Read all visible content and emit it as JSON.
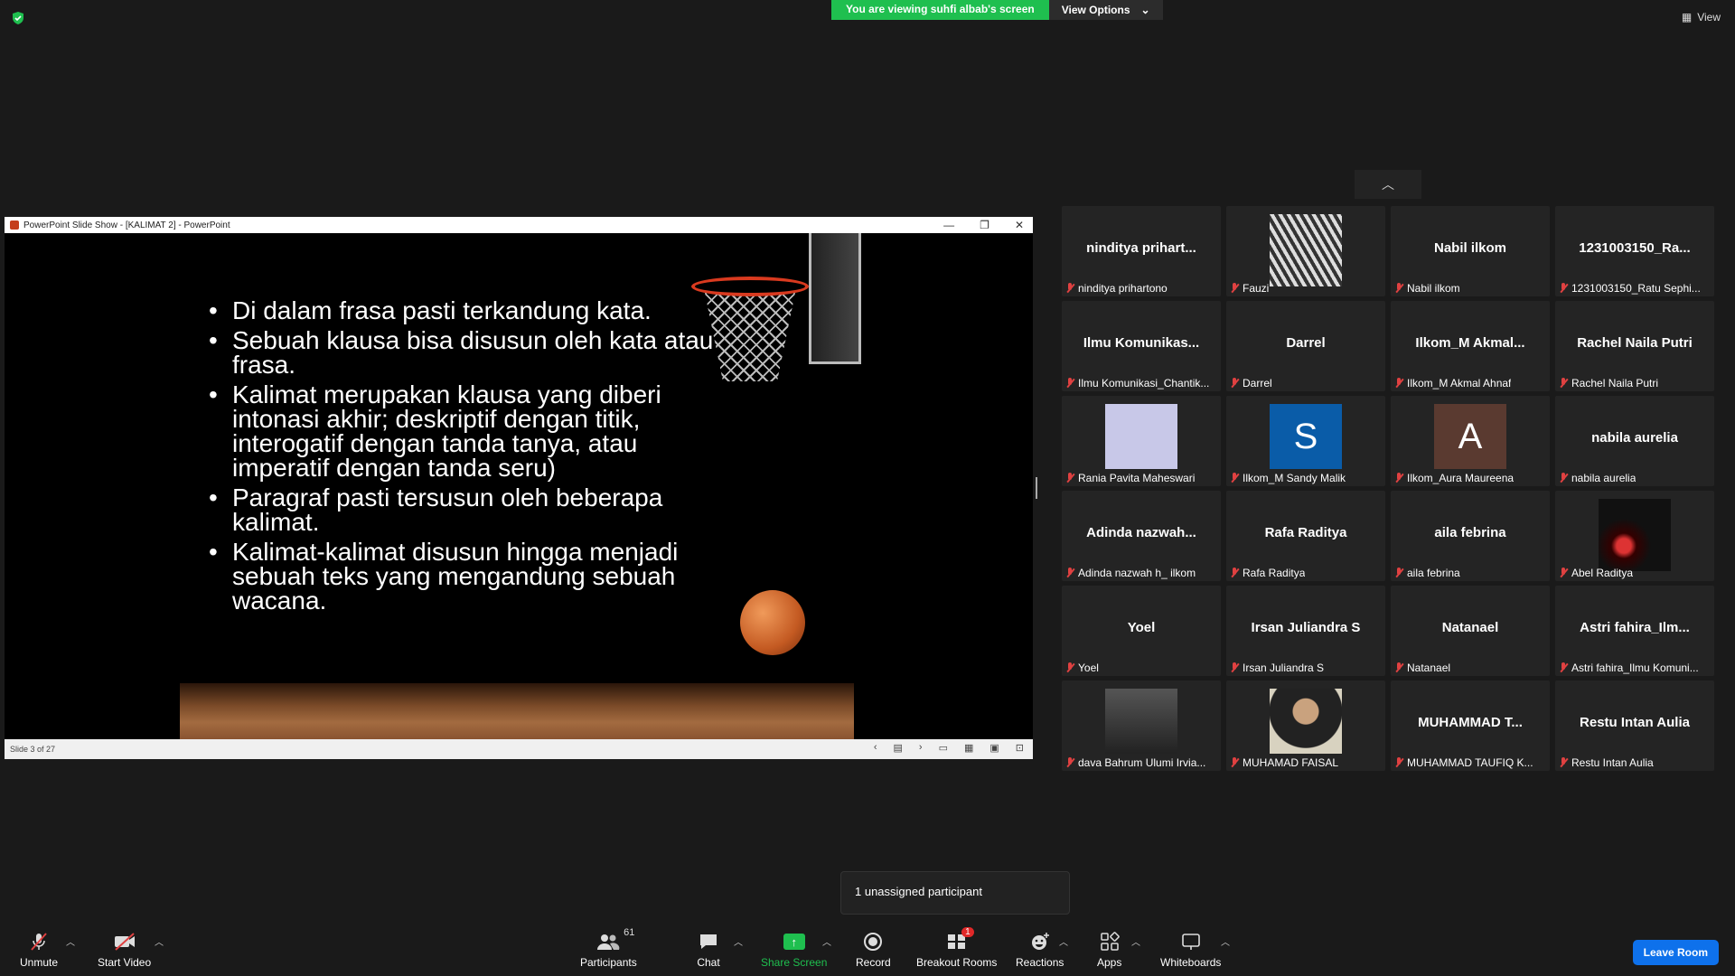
{
  "banner": {
    "viewing_text": "You are viewing suhfi albab's screen",
    "view_options_label": "View Options",
    "view_label": "View"
  },
  "shared_window": {
    "title": "PowerPoint Slide Show - [KALIMAT 2] - PowerPoint",
    "slide_status": "Slide 3 of 27",
    "bullets": [
      "Di dalam frasa pasti terkandung kata.",
      "Sebuah klausa bisa disusun oleh kata atau frasa.",
      "Kalimat merupakan klausa yang diberi intonasi akhir; deskriptif dengan titik, interogatif dengan tanda tanya, atau imperatif dengan tanda seru)",
      "Paragraf pasti tersusun oleh beberapa kalimat.",
      "Kalimat-kalimat disusun hingga menjadi sebuah teks yang mengandung sebuah wacana."
    ]
  },
  "gallery": {
    "tiles": [
      {
        "big": "ninditya  prihart...",
        "name": "ninditya prihartono",
        "media": "text"
      },
      {
        "big": "",
        "name": "Fauzi",
        "media": "photo-pattern"
      },
      {
        "big": "Nabil ilkom",
        "name": "Nabil ilkom",
        "media": "text"
      },
      {
        "big": "1231003150_Ra...",
        "name": "1231003150_Ratu Sephi...",
        "media": "text"
      },
      {
        "big": "Ilmu  Komunikas...",
        "name": "Ilmu Komunikasi_Chantik...",
        "media": "text"
      },
      {
        "big": "Darrel",
        "name": "Darrel",
        "media": "text"
      },
      {
        "big": "Ilkom_M  Akmal...",
        "name": "Ilkom_M Akmal Ahnaf",
        "media": "text"
      },
      {
        "big": "Rachel Naila Putri",
        "name": "Rachel Naila Putri",
        "media": "text"
      },
      {
        "big": "",
        "name": "Rania Pavita Maheswari",
        "media": "lavender"
      },
      {
        "big": "",
        "name": "Ilkom_M Sandy Malik",
        "media": "letter",
        "letter": "S",
        "color": "#0a5ca8"
      },
      {
        "big": "",
        "name": "Ilkom_Aura Maureena",
        "media": "letter",
        "letter": "A",
        "color": "#5a3a30"
      },
      {
        "big": "nabila aurelia",
        "name": "nabila aurelia",
        "media": "text"
      },
      {
        "big": "Adinda  nazwah...",
        "name": "Adinda nazwah h_ ilkom",
        "media": "text"
      },
      {
        "big": "Rafa Raditya",
        "name": "Rafa Raditya",
        "media": "text"
      },
      {
        "big": "aila febrina",
        "name": "aila febrina",
        "media": "text"
      },
      {
        "big": "",
        "name": "Abel Raditya",
        "media": "dark-red"
      },
      {
        "big": "Yoel",
        "name": "Yoel",
        "media": "text"
      },
      {
        "big": "Irsan Juliandra S",
        "name": "Irsan Juliandra S",
        "media": "text"
      },
      {
        "big": "Natanael",
        "name": "Natanael",
        "media": "text"
      },
      {
        "big": "Astri  fahira_Ilm...",
        "name": "Astri fahira_Ilmu Komuni...",
        "media": "text"
      },
      {
        "big": "",
        "name": "dava Bahrum Ulumi Irvia...",
        "media": "photo-dark"
      },
      {
        "big": "",
        "name": "MUHAMAD FAISAL",
        "media": "photo-person"
      },
      {
        "big": "MUHAMMAD  T...",
        "name": "MUHAMMAD TAUFIQ K...",
        "media": "text"
      },
      {
        "big": "Restu Intan Aulia",
        "name": "Restu Intan Aulia",
        "media": "text"
      }
    ]
  },
  "popover": {
    "text": "1 unassigned participant"
  },
  "toolbar": {
    "unmute": "Unmute",
    "start_video": "Start Video",
    "participants": "Participants",
    "participants_count": "61",
    "chat": "Chat",
    "share_screen": "Share Screen",
    "record": "Record",
    "breakout_rooms": "Breakout Rooms",
    "breakout_badge": "1",
    "reactions": "Reactions",
    "apps": "Apps",
    "whiteboards": "Whiteboards",
    "leave_room": "Leave Room"
  },
  "colors": {
    "accent_green": "#1fbf4f",
    "leave_blue": "#0e71eb",
    "muted_red": "#e04141"
  }
}
